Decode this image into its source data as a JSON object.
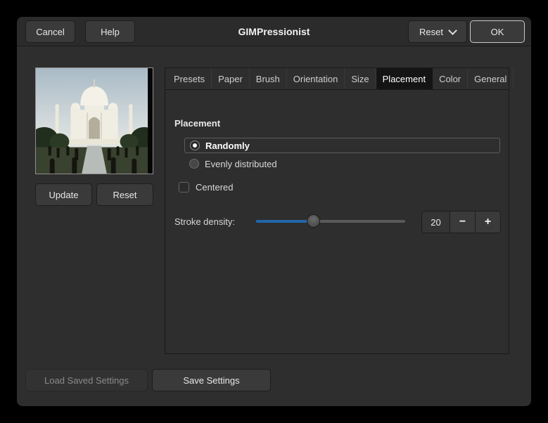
{
  "window": {
    "title": "GIMPressionist",
    "cancel": "Cancel",
    "help": "Help",
    "reset": "Reset",
    "ok": "OK"
  },
  "preview": {
    "update": "Update",
    "reset": "Reset"
  },
  "tabs": [
    {
      "label": "Presets",
      "selected": false
    },
    {
      "label": "Paper",
      "selected": false
    },
    {
      "label": "Brush",
      "selected": false
    },
    {
      "label": "Orientation",
      "selected": false
    },
    {
      "label": "Size",
      "selected": false
    },
    {
      "label": "Placement",
      "selected": true
    },
    {
      "label": "Color",
      "selected": false
    },
    {
      "label": "General",
      "selected": false
    }
  ],
  "placement": {
    "heading": "Placement",
    "options": [
      {
        "label": "Randomly",
        "selected": true
      },
      {
        "label": "Evenly distributed",
        "selected": false
      }
    ],
    "centered_label": "Centered",
    "centered_checked": false,
    "stroke_density_label": "Stroke density:",
    "stroke_density_value": "20",
    "decrement_label": "−",
    "increment_label": "+"
  },
  "footer": {
    "load": "Load Saved Settings",
    "load_enabled": false,
    "save": "Save Settings"
  },
  "colors": {
    "accent_blue": "#2266aa",
    "dialog_bg": "#2e2e2e",
    "selected_tab_bg": "#141414"
  }
}
